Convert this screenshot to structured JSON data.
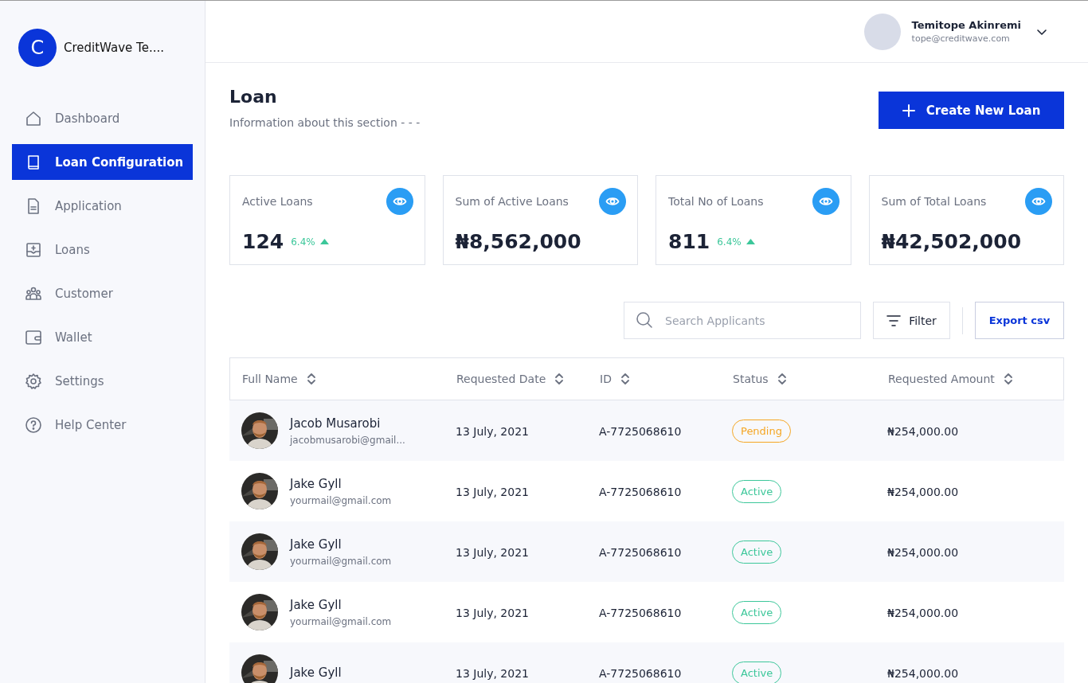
{
  "sidebar": {
    "brand": {
      "initial": "C",
      "name": "CreditWave Te...."
    },
    "items": [
      {
        "label": "Dashboard",
        "selected": false
      },
      {
        "label": "Loan Configuration",
        "selected": true
      },
      {
        "label": "Application",
        "selected": false
      },
      {
        "label": "Loans",
        "selected": false
      },
      {
        "label": "Customer",
        "selected": false
      },
      {
        "label": "Wallet",
        "selected": false
      },
      {
        "label": "Settings",
        "selected": false
      },
      {
        "label": "Help Center",
        "selected": false
      }
    ]
  },
  "user": {
    "name": "Temitope Akinremi",
    "email": "tope@creditwave.com"
  },
  "page": {
    "title": "Loan",
    "subtitle": "Information about this section - - -",
    "create_button": "Create New Loan"
  },
  "stats": [
    {
      "label": "Active Loans",
      "value": "124",
      "change": "6.4%"
    },
    {
      "label": "Sum of Active Loans",
      "value": "₦8,562,000"
    },
    {
      "label": "Total No of Loans",
      "value": "811",
      "change": "6.4%"
    },
    {
      "label": "Sum of Total Loans",
      "value": "₦42,502,000"
    }
  ],
  "toolbar": {
    "search_placeholder": "Search Applicants",
    "filter_button": "Filter",
    "export_button": "Export csv"
  },
  "table": {
    "columns": [
      "Full Name",
      "Requested Date",
      "ID",
      "Status",
      "Requested Amount"
    ],
    "rows": [
      {
        "name": "Jacob Musarobi",
        "email": "jacobmusarobi@gmail...",
        "date": "13 July, 2021",
        "id": "A-7725068610",
        "status": "Pending",
        "color": "#f5a623",
        "amount": "₦254,000.00"
      },
      {
        "name": "Jake Gyll",
        "email": "yourmail@gmail.com",
        "date": "13 July, 2021",
        "id": "A-7725068610",
        "status": "Active",
        "color": "#3cc79a",
        "amount": "₦254,000.00"
      },
      {
        "name": "Jake Gyll",
        "email": "yourmail@gmail.com",
        "date": "13 July, 2021",
        "id": "A-7725068610",
        "status": "Active",
        "color": "#3cc79a",
        "amount": "₦254,000.00"
      },
      {
        "name": "Jake Gyll",
        "email": "yourmail@gmail.com",
        "date": "13 July, 2021",
        "id": "A-7725068610",
        "status": "Active",
        "color": "#3cc79a",
        "amount": "₦254,000.00"
      },
      {
        "name": "Jake Gyll",
        "date": "13 July, 2021",
        "id": "A-7725068610",
        "status": "Active",
        "color": "#3cc79a",
        "amount": "₦254,000.00"
      }
    ]
  }
}
